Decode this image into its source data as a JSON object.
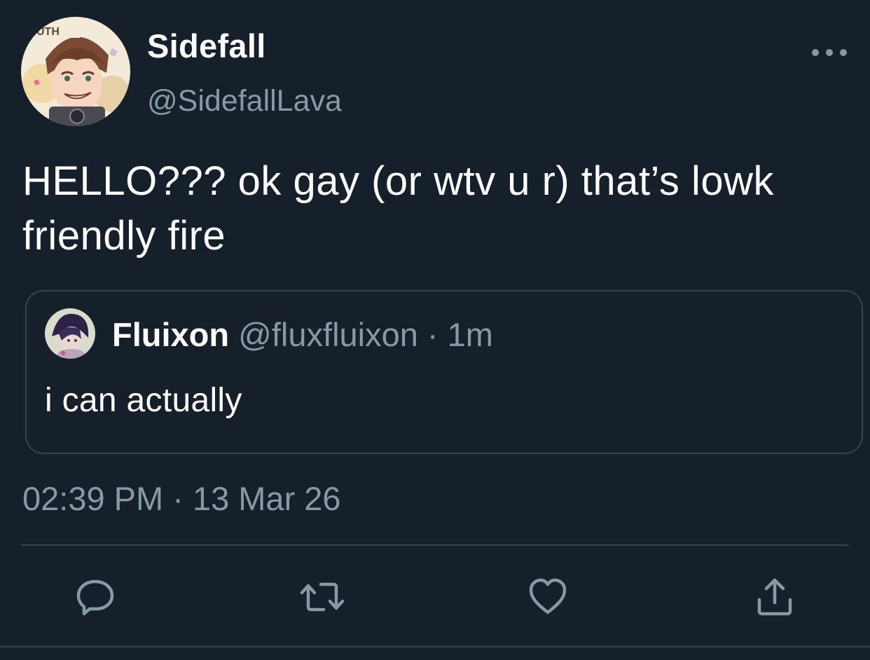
{
  "author": {
    "display_name": "Sidefall",
    "handle": "@SidefallLava",
    "avatar_badge": "UTH"
  },
  "tweet": {
    "text": "HELLO??? ok gay (or wtv u r) that’s lowk friendly fire",
    "timestamp": "02:39 PM · 13 Mar 26"
  },
  "quoted_tweet": {
    "display_name": "Fluixon",
    "meta": "@fluxfluixon · 1m",
    "text": "i can actually"
  },
  "icons": {
    "more": "more-horizontal-icon",
    "reply": "reply-icon",
    "retweet": "retweet-icon",
    "like": "heart-icon",
    "share": "share-icon"
  },
  "colors": {
    "background": "#15202b",
    "text_primary": "#ffffff",
    "text_secondary": "#8899a6",
    "border": "#38444d"
  }
}
